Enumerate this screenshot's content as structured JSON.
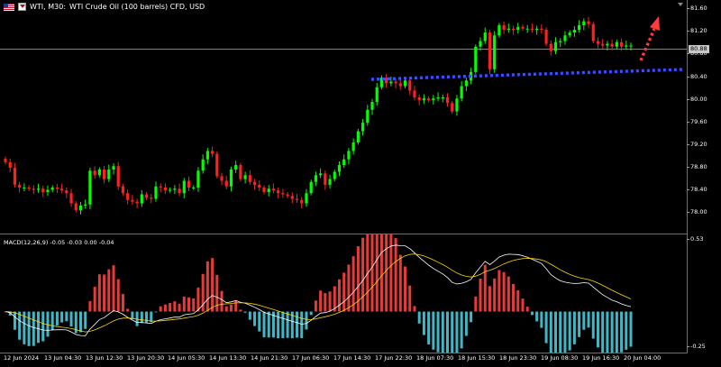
{
  "header": {
    "symbol": "WTI, M30:",
    "description": "WTI Crude Oil (100 barrels) CFD, USD"
  },
  "indicator": {
    "label": "MACD(12,26,9) -0.05 -0.03 0.00 -0.04"
  },
  "price_axis": {
    "labels": [
      "81.60",
      "81.20",
      "80.80",
      "80.40",
      "80.00",
      "79.60",
      "79.20",
      "78.80",
      "78.40",
      "78.00"
    ],
    "current_price": "80.88"
  },
  "macd_axis": {
    "labels": [
      "0.53",
      "-0.25"
    ]
  },
  "time_axis": {
    "labels": [
      "12 Jun 2024",
      "13 Jun 04:30",
      "13 Jun 12:30",
      "13 Jun 20:30",
      "14 Jun 05:30",
      "14 Jun 13:30",
      "14 Jun 21:30",
      "17 Jun 06:30",
      "17 Jun 14:30",
      "17 Jun 22:30",
      "18 Jun 07:30",
      "18 Jun 15:30",
      "18 Jun 23:30",
      "19 Jun 08:30",
      "19 Jun 16:30",
      "20 Jun 04:00"
    ]
  },
  "colors": {
    "bull": "#00ff00",
    "bear": "#ff2020",
    "macd_line": "#ffffff",
    "signal_line": "#ffd700",
    "hist_pos": "#e83a3a",
    "hist_neg": "#3fb7c6",
    "support_line": "#3a4fff",
    "arrow": "#ff3b3b"
  },
  "chart_data": {
    "type": "line",
    "title": "",
    "xlabel": "",
    "ylabel": "",
    "ylim": [
      77.8,
      81.7
    ],
    "series": [
      {
        "values": [
          78.85,
          78.75,
          78.45,
          78.4,
          78.4,
          78.38,
          78.36,
          78.38,
          78.32,
          78.36,
          78.4,
          78.38,
          78.35,
          78.3,
          78.12,
          78.0,
          78.08,
          78.1,
          78.7,
          78.62,
          78.72,
          78.55,
          78.72,
          78.78,
          78.42,
          78.3,
          78.18,
          78.15,
          78.12,
          78.28,
          78.22,
          78.2,
          78.42,
          78.4,
          78.35,
          78.36,
          78.38,
          78.3,
          78.52,
          78.4,
          78.4,
          78.7,
          78.9,
          79.05,
          79.0,
          78.6,
          78.52,
          78.42,
          78.72,
          78.8,
          78.55,
          78.62,
          78.5,
          78.45,
          78.4,
          78.32,
          78.38,
          78.35,
          78.3,
          78.28,
          78.25,
          78.2,
          78.18,
          78.12,
          78.3,
          78.5,
          78.62,
          78.65,
          78.45,
          78.55,
          78.68,
          78.8,
          78.9,
          79.05,
          79.2,
          79.4,
          79.55,
          79.78,
          79.92,
          80.18,
          80.35,
          80.25,
          80.28,
          80.25,
          80.2,
          80.3,
          80.12,
          80.0,
          79.95,
          79.98,
          79.95,
          79.98,
          80.0,
          80.0,
          79.9,
          79.75,
          79.98,
          80.2,
          80.3,
          80.45,
          80.9,
          81.0,
          81.15,
          80.5,
          81.1,
          81.28,
          81.2,
          81.22,
          81.2,
          81.25,
          81.22,
          81.22,
          81.2,
          81.22,
          81.2,
          80.95,
          80.82,
          80.98,
          81.0,
          81.1,
          81.15,
          81.2,
          81.28,
          81.35,
          81.3,
          81.0,
          80.95,
          80.92,
          80.95,
          80.9,
          80.98,
          80.9,
          80.92,
          80.92
        ]
      }
    ]
  }
}
